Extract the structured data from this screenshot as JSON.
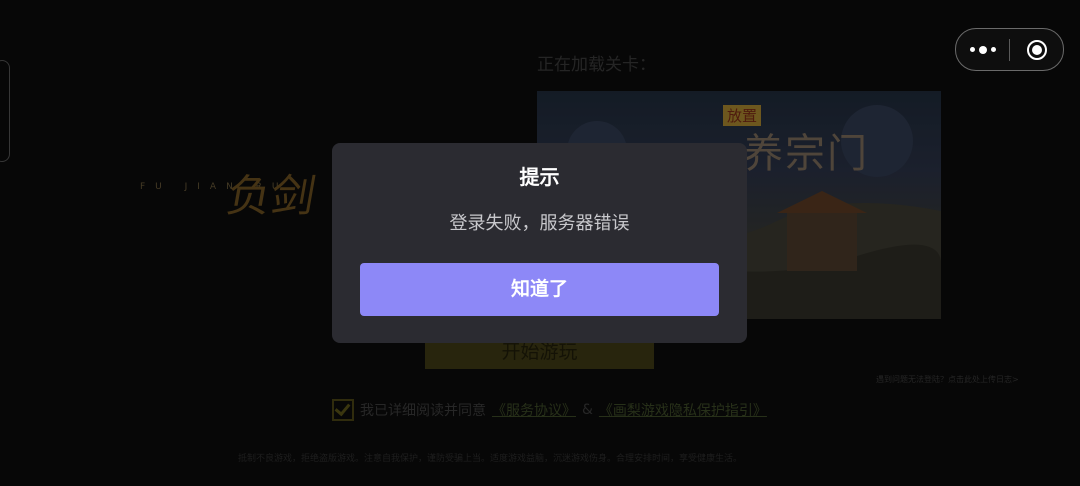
{
  "background": {
    "logo_sub": "FU JIAN RU",
    "logo_cn": "负剑",
    "loading_label": "正在加载关卡：",
    "banner_tag": "放置",
    "banner_title": "养宗门",
    "start_button": "开始游玩",
    "help_text": "遇到问题无法登陆？点击此处上传日志>",
    "agree_prefix": "我已详细阅读并同意",
    "agree_link1": "《服务协议》",
    "agree_and": "&",
    "agree_link2": "《画梨游戏隐私保护指引》",
    "footer_note": "抵制不良游戏，拒绝盗版游戏。注意自我保护，谨防受骗上当。适度游戏益脑，沉迷游戏伤身。合理安排时间，享受健康生活。"
  },
  "capsule": {
    "more_icon": "more-dots-icon",
    "close_icon": "target-close-icon"
  },
  "dialog": {
    "title": "提示",
    "message": "登录失败，服务器错误",
    "confirm_label": "知道了"
  },
  "colors": {
    "dialog_bg": "#2b2b31",
    "button": "#8d88f7"
  }
}
